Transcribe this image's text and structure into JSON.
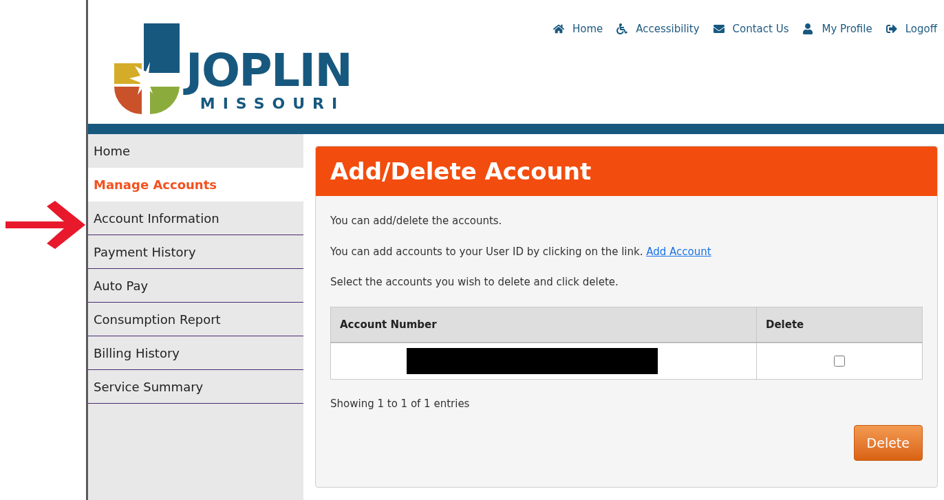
{
  "logo": {
    "title": "JOPLIN",
    "subtitle": "MISSOURI"
  },
  "top_nav": [
    {
      "label": "Home",
      "kind": "home"
    },
    {
      "label": "Accessibility",
      "kind": "accessibility"
    },
    {
      "label": "Contact Us",
      "kind": "mail"
    },
    {
      "label": "My Profile",
      "kind": "user"
    },
    {
      "label": "Logoff",
      "kind": "logoff"
    }
  ],
  "sidebar": {
    "items": [
      {
        "label": "Home",
        "selected": false
      },
      {
        "label": "Manage Accounts",
        "selected": true
      },
      {
        "label": "Account Information",
        "selected": false
      },
      {
        "label": "Payment History",
        "selected": false
      },
      {
        "label": "Auto Pay",
        "selected": false
      },
      {
        "label": "Consumption Report",
        "selected": false
      },
      {
        "label": "Billing History",
        "selected": false
      },
      {
        "label": "Service Summary",
        "selected": false
      }
    ]
  },
  "panel": {
    "title": "Add/Delete Account",
    "intro": "You can add/delete the accounts.",
    "add_text": "You can add accounts to your User ID by clicking on the link.",
    "add_link": "Add Account",
    "instructions": "Select the accounts you wish to delete and click delete.",
    "table": {
      "columns": [
        "Account Number",
        "Delete"
      ],
      "rows": [
        {
          "checked": false
        }
      ]
    },
    "footer": "Showing 1 to 1 of 1 entries",
    "button": "Delete"
  }
}
